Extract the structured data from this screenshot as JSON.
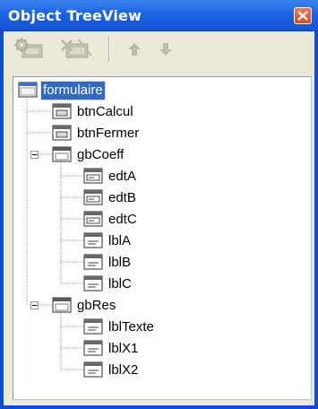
{
  "window": {
    "title": "Object TreeView"
  },
  "toolbar": {
    "buttons": [
      {
        "name": "add-component-button",
        "icon": "component-gear-icon",
        "enabled": false
      },
      {
        "name": "delete-component-button",
        "icon": "component-delete-icon",
        "enabled": false
      },
      {
        "name": "move-up-button",
        "icon": "arrow-up-icon",
        "enabled": false
      },
      {
        "name": "move-down-button",
        "icon": "arrow-down-icon",
        "enabled": false
      }
    ]
  },
  "tree": {
    "nodes": [
      {
        "label": "formulaire",
        "depth": 0,
        "icon": "form-icon",
        "selected": true
      },
      {
        "label": "btnCalcul",
        "depth": 1,
        "icon": "button-icon"
      },
      {
        "label": "btnFermer",
        "depth": 1,
        "icon": "button-icon"
      },
      {
        "label": "gbCoeff",
        "depth": 1,
        "icon": "groupbox-icon",
        "expanded": true
      },
      {
        "label": "edtA",
        "depth": 2,
        "icon": "edit-icon"
      },
      {
        "label": "edtB",
        "depth": 2,
        "icon": "edit-icon"
      },
      {
        "label": "edtC",
        "depth": 2,
        "icon": "edit-icon"
      },
      {
        "label": "lblA",
        "depth": 2,
        "icon": "label-icon"
      },
      {
        "label": "lblB",
        "depth": 2,
        "icon": "label-icon"
      },
      {
        "label": "lblC",
        "depth": 2,
        "icon": "label-icon"
      },
      {
        "label": "gbRes",
        "depth": 1,
        "icon": "groupbox-icon",
        "expanded": true
      },
      {
        "label": "lblTexte",
        "depth": 2,
        "icon": "label-icon"
      },
      {
        "label": "lblX1",
        "depth": 2,
        "icon": "label-icon"
      },
      {
        "label": "lblX2",
        "depth": 2,
        "icon": "label-icon"
      }
    ]
  },
  "colors": {
    "titlebar": "#1c63e6",
    "selection": "#316ac5",
    "panel": "#ece9d8",
    "close_button": "#d64a20"
  }
}
